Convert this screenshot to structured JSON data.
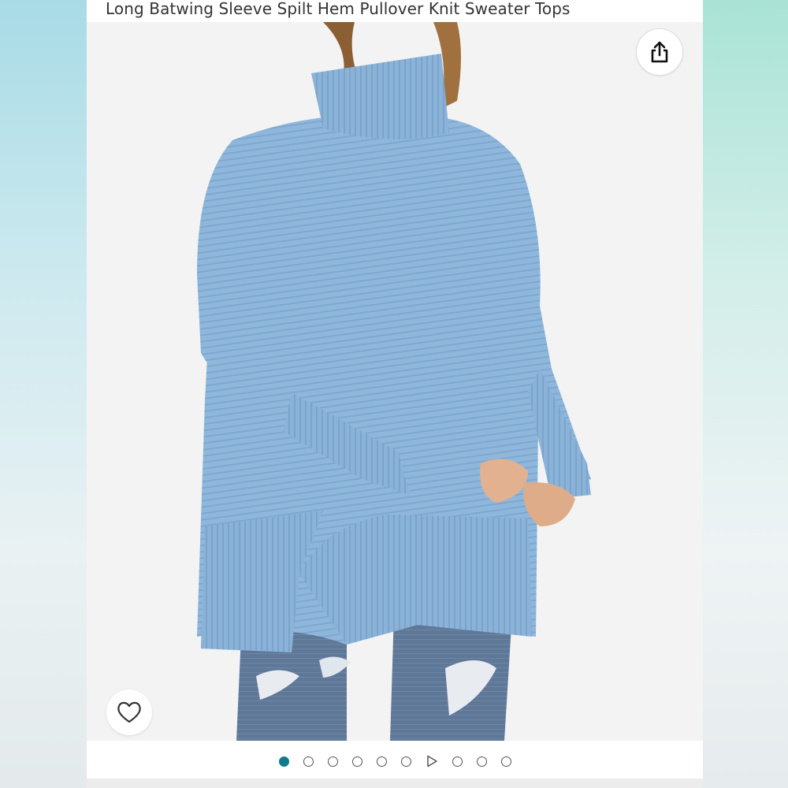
{
  "product": {
    "title": "Long Batwing Sleeve Spilt Hem Pullover Knit Sweater Tops"
  },
  "image": {
    "alt": "Woman wearing light blue turtleneck batwing sleeve knit sweater with split hem and ripped jeans",
    "sweater_color": "#8fb7db",
    "jeans_color": "#5d7696"
  },
  "actions": {
    "share_icon": "share-icon",
    "wishlist_icon": "heart-icon"
  },
  "carousel": {
    "items": [
      "image",
      "image",
      "image",
      "image",
      "image",
      "image",
      "video",
      "image",
      "image",
      "image"
    ],
    "active_index": 0,
    "accent": "#0f7b8a"
  }
}
